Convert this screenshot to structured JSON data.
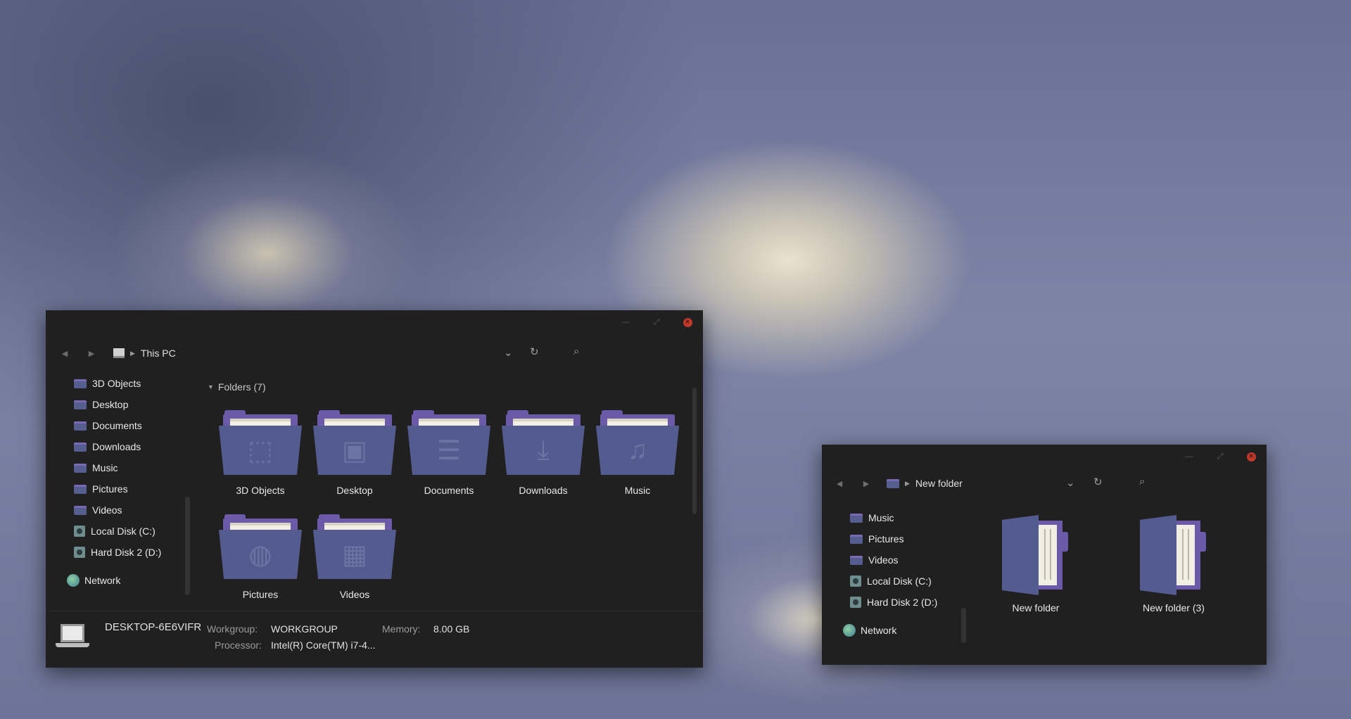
{
  "window1": {
    "address": "This PC",
    "sidebar": [
      {
        "label": "3D Objects",
        "icon": "folder-icon"
      },
      {
        "label": "Desktop",
        "icon": "folder-icon"
      },
      {
        "label": "Documents",
        "icon": "folder-icon"
      },
      {
        "label": "Downloads",
        "icon": "folder-icon"
      },
      {
        "label": "Music",
        "icon": "folder-icon"
      },
      {
        "label": "Pictures",
        "icon": "folder-icon"
      },
      {
        "label": "Videos",
        "icon": "folder-icon"
      },
      {
        "label": "Local Disk (C:)",
        "icon": "drive-icon"
      },
      {
        "label": "Hard Disk 2 (D:)",
        "icon": "drive-icon"
      }
    ],
    "network_label": "Network",
    "group_header": "Folders (7)",
    "folders": [
      {
        "label": "3D Objects",
        "glyph": "⬚"
      },
      {
        "label": "Desktop",
        "glyph": "▣"
      },
      {
        "label": "Documents",
        "glyph": "☰"
      },
      {
        "label": "Downloads",
        "glyph": "⤓"
      },
      {
        "label": "Music",
        "glyph": "♫"
      },
      {
        "label": "Pictures",
        "glyph": "◍"
      },
      {
        "label": "Videos",
        "glyph": "▦"
      }
    ],
    "status": {
      "computer_name": "DESKTOP-6E6VIFR",
      "workgroup_label": "Workgroup:",
      "workgroup_value": "WORKGROUP",
      "memory_label": "Memory:",
      "memory_value": "8.00 GB",
      "processor_label": "Processor:",
      "processor_value": "Intel(R) Core(TM) i7-4..."
    }
  },
  "window2": {
    "address": "New folder",
    "sidebar": [
      {
        "label": "Music",
        "icon": "folder-icon"
      },
      {
        "label": "Pictures",
        "icon": "folder-icon"
      },
      {
        "label": "Videos",
        "icon": "folder-icon"
      },
      {
        "label": "Local Disk (C:)",
        "icon": "drive-icon"
      },
      {
        "label": "Hard Disk 2 (D:)",
        "icon": "drive-icon"
      }
    ],
    "network_label": "Network",
    "items": [
      {
        "label": "New folder"
      },
      {
        "label": "New folder (3)"
      }
    ]
  },
  "colors": {
    "window_bg": "#202020",
    "folder_front": "#545c8f",
    "folder_back": "#6a5aa8",
    "close_button": "#c0392b"
  }
}
